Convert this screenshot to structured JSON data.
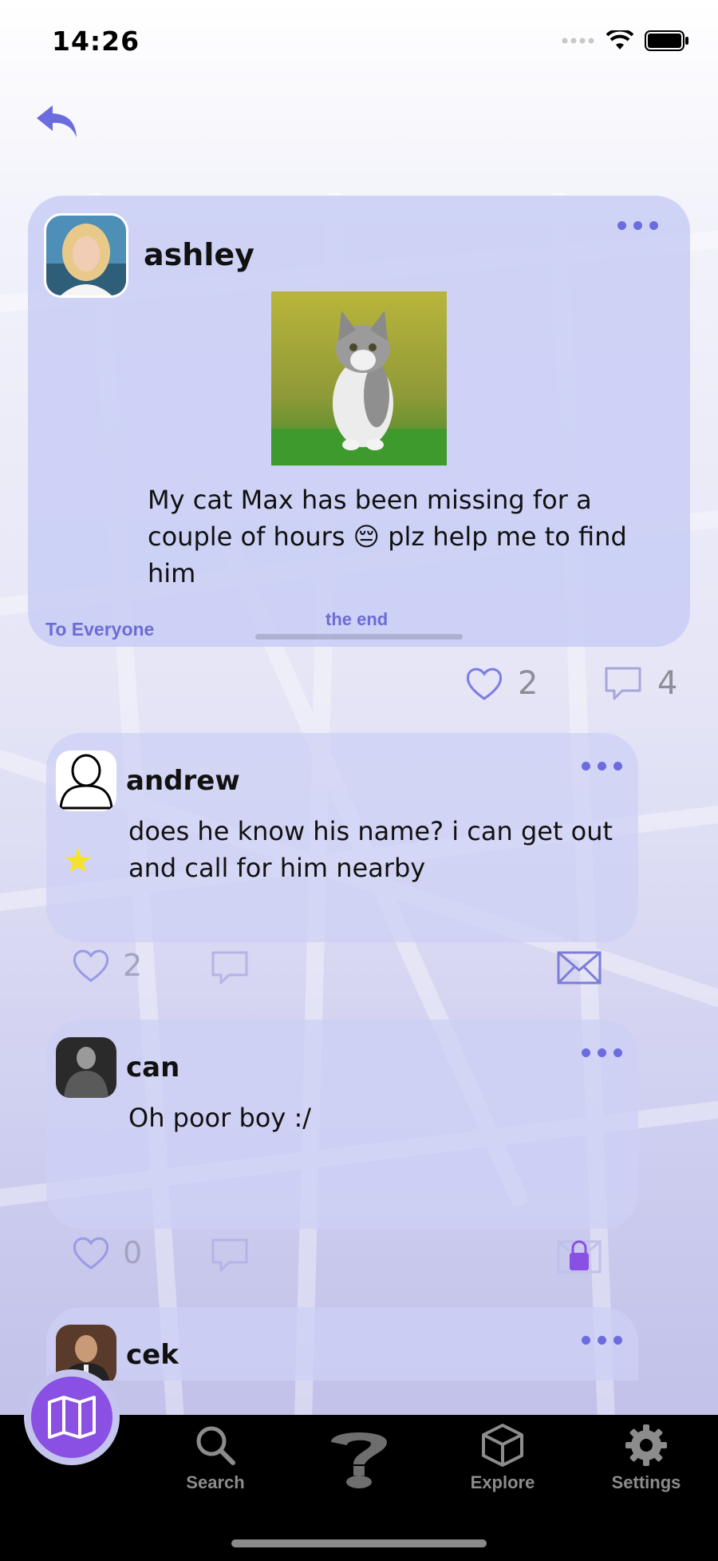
{
  "status_bar": {
    "time": "14:26"
  },
  "post": {
    "username": "ashley",
    "text": "My cat Max has been missing for a couple of hours 😔 plz help me to find him",
    "audience": "To Everyone",
    "end_label": "the end",
    "likes": "2",
    "comments": "4"
  },
  "comments": [
    {
      "username": "andrew",
      "text": "does he know his name? i can get out and call for him nearby",
      "likes": "2"
    },
    {
      "username": "can",
      "text": "Oh poor boy :/",
      "likes": "0"
    },
    {
      "username": "cek",
      "text": ""
    }
  ],
  "tabbar": {
    "search_label": "Search",
    "explore_label": "Explore",
    "settings_label": "Settings"
  },
  "colors": {
    "accent": "#6c6ce0",
    "card": "#c4caf5",
    "fab": "#8a4fe3",
    "star": "#f7e22b",
    "tabbar": "#000000"
  },
  "icons": {
    "back": "back-arrow-icon",
    "more": "more-dots-icon",
    "like": "heart-icon",
    "comment": "comment-bubble-icon",
    "message": "envelope-icon",
    "locked": "lock-icon",
    "map": "map-icon",
    "search": "search-icon",
    "ask": "question-icon",
    "explore": "cube-icon",
    "settings": "gear-icon"
  }
}
